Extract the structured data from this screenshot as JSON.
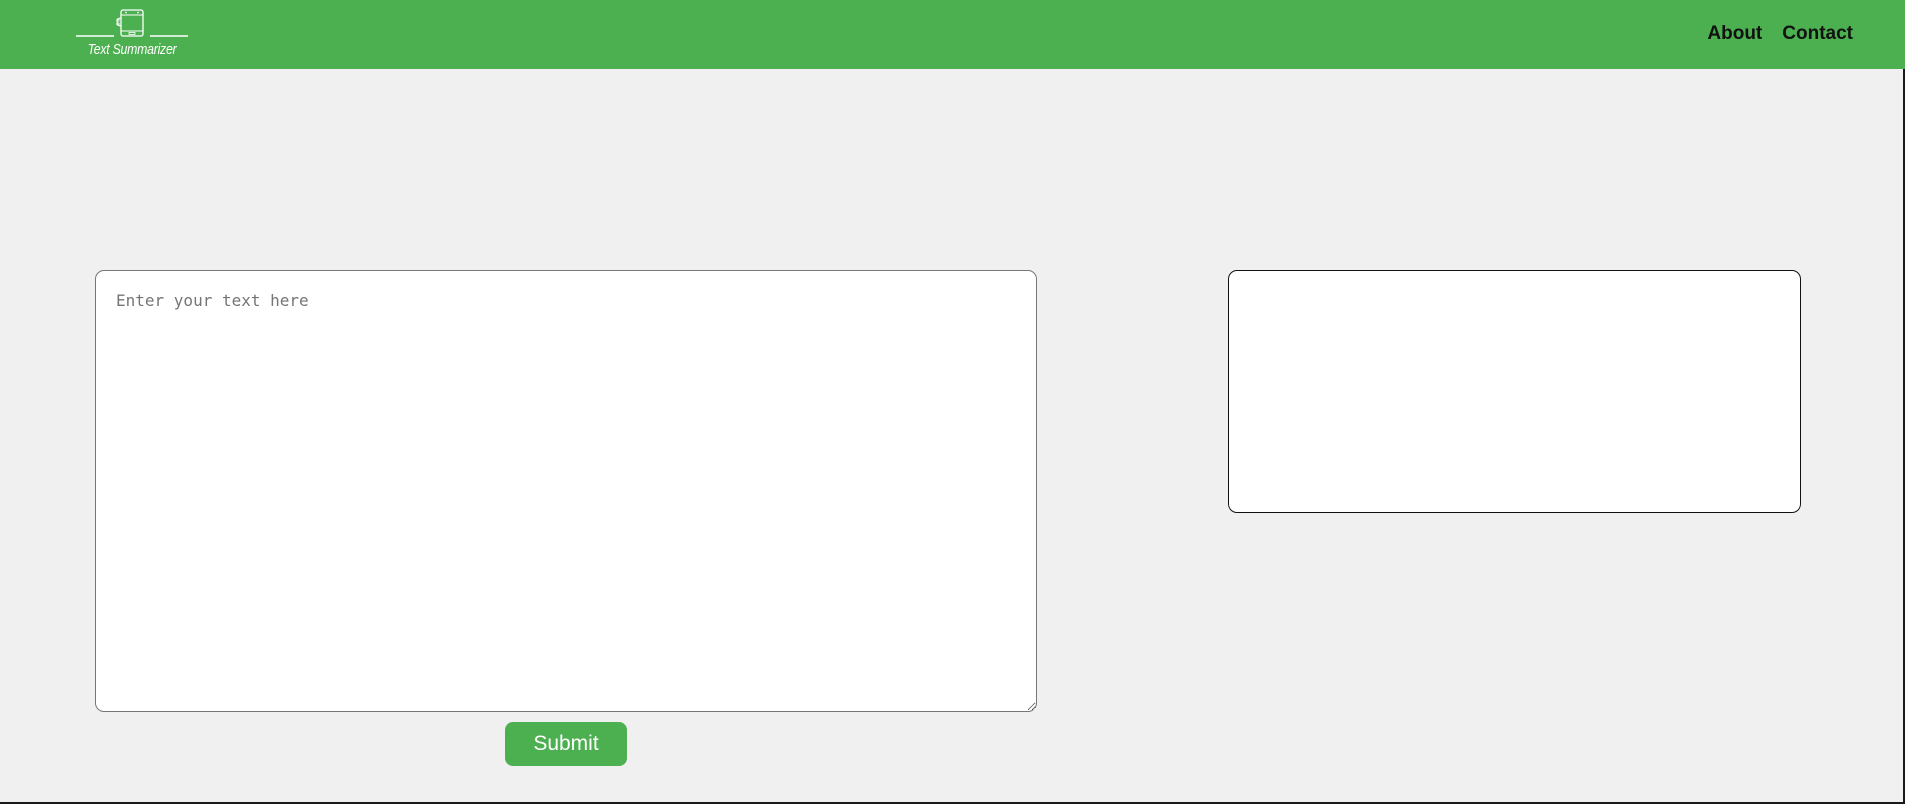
{
  "navbar": {
    "logo_text": "Text Summarizer",
    "links": [
      {
        "label": "About"
      },
      {
        "label": "Contact"
      }
    ]
  },
  "main": {
    "input_placeholder": "Enter your text here",
    "input_value": "",
    "submit_label": "Submit",
    "summary_output": ""
  },
  "colors": {
    "brand_green": "#4caf50",
    "page_background": "#f0f0f0"
  },
  "icons": {
    "logo_icon": "document-icon"
  }
}
